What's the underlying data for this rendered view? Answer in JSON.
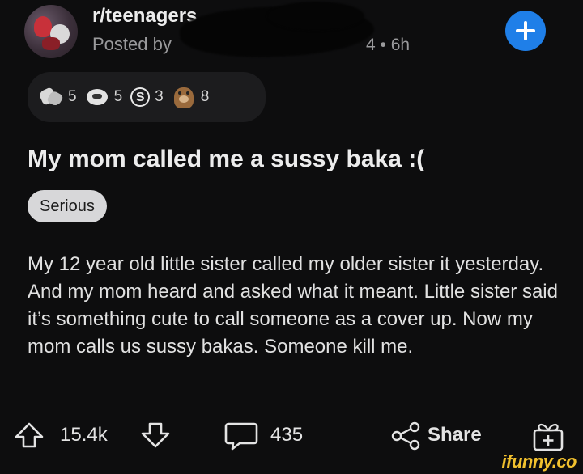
{
  "header": {
    "subreddit": "r/teenagers",
    "posted_by": "Posted by",
    "timestamp": "4 • 6h"
  },
  "awards": [
    {
      "icon": "hands-award-icon",
      "count": "5"
    },
    {
      "icon": "face-award-icon",
      "count": "5"
    },
    {
      "icon": "dollar-award-icon",
      "count": "3",
      "glyph": "S"
    },
    {
      "icon": "bear-award-icon",
      "count": "8"
    }
  ],
  "post": {
    "title": "My mom called me a sussy baka :(",
    "flair": "Serious",
    "body": "My 12 year old little sister called my older sister it yesterday. And my mom heard and asked what it meant. Little sister said it’s something cute to call someone as a cover up. Now my mom calls us sussy bakas. Someone kill me."
  },
  "actions": {
    "vote_count": "15.4k",
    "comment_count": "435",
    "share_label": "Share"
  },
  "watermark": "ifunny.co",
  "colors": {
    "background": "#0d0d0e",
    "accent_blue": "#1f7fe8",
    "flair_bg": "#d7d7d9",
    "watermark_yellow": "#f2c12e"
  }
}
